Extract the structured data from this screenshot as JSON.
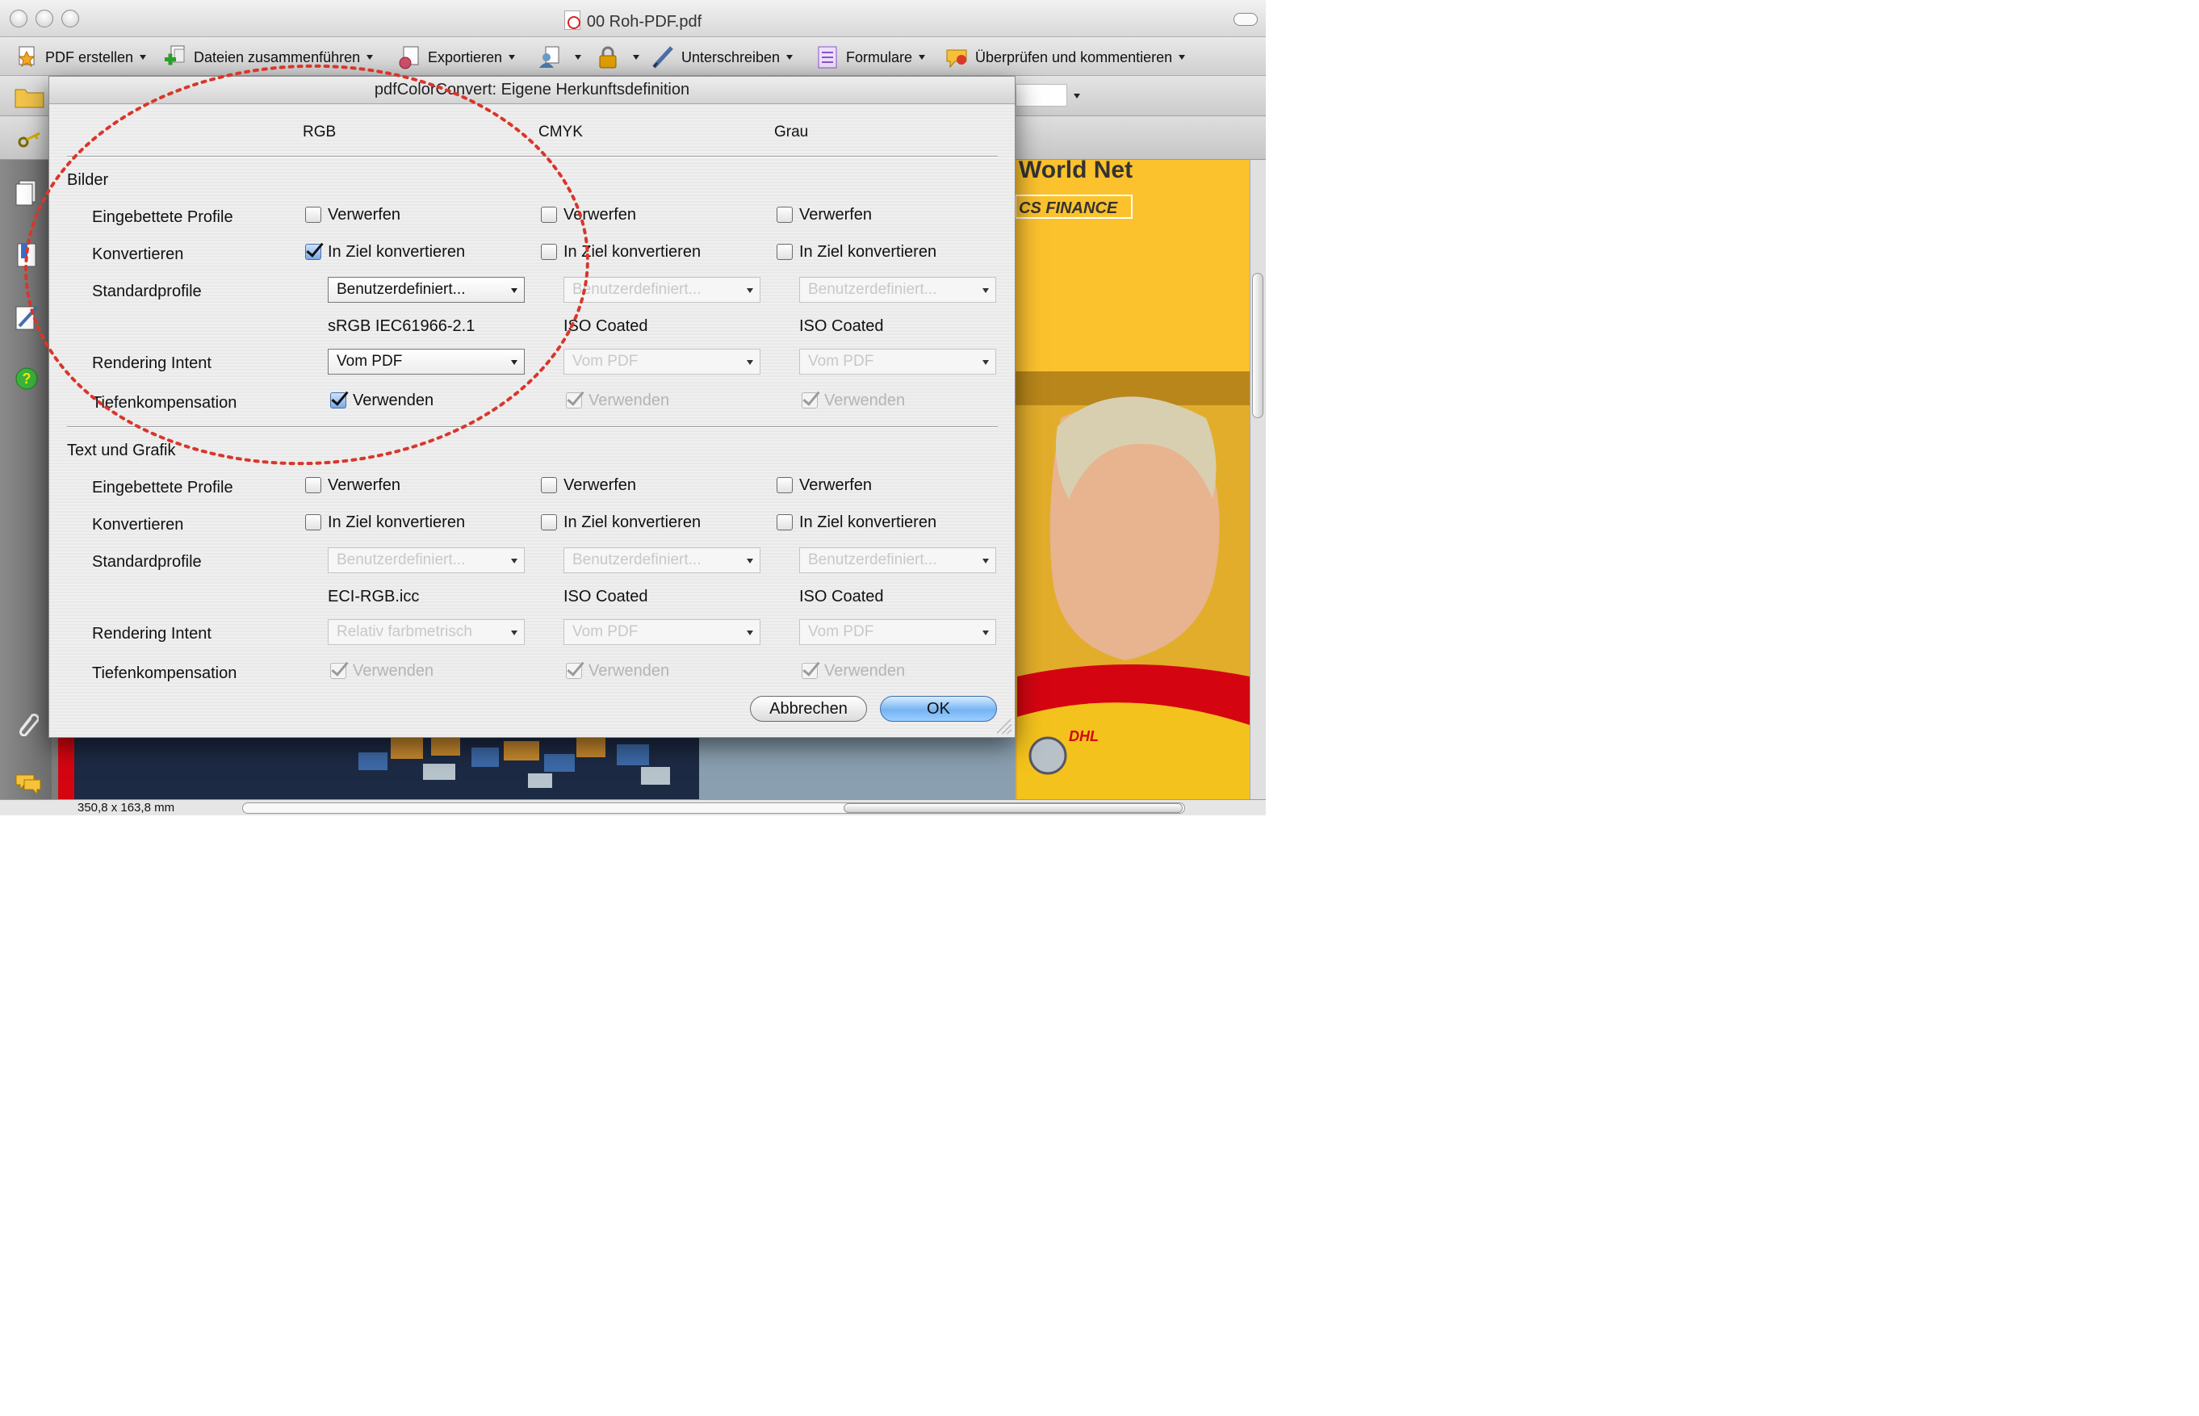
{
  "window": {
    "title": "00 Roh-PDF.pdf"
  },
  "toolbar": {
    "items": [
      {
        "label": "PDF erstellen",
        "icon": "create-pdf-icon"
      },
      {
        "label": "Dateien zusammenführen",
        "icon": "merge-files-icon"
      },
      {
        "label": "Exportieren",
        "icon": "export-icon"
      },
      {
        "label": "",
        "icon": "user-icon"
      },
      {
        "label": "",
        "icon": "lock-icon"
      },
      {
        "label": "Unterschreiben",
        "icon": "sign-pen-icon"
      },
      {
        "label": "Formulare",
        "icon": "forms-icon"
      },
      {
        "label": "Überprüfen und kommentieren",
        "icon": "review-comment-icon"
      }
    ]
  },
  "dialog": {
    "title": "pdfColorConvert: Eigene Herkunftsdefinition",
    "columns": [
      "RGB",
      "CMYK",
      "Grau"
    ],
    "sections": [
      {
        "title": "Bilder",
        "rows": {
          "embedded_label": "Eingebettete Profile",
          "embedded": [
            {
              "label": "Verwerfen",
              "checked": false,
              "enabled": true
            },
            {
              "label": "Verwerfen",
              "checked": false,
              "enabled": true
            },
            {
              "label": "Verwerfen",
              "checked": false,
              "enabled": true
            }
          ],
          "convert_label": "Konvertieren",
          "convert": [
            {
              "label": "In Ziel konvertieren",
              "checked": true,
              "enabled": true
            },
            {
              "label": "In Ziel konvertieren",
              "checked": false,
              "enabled": true
            },
            {
              "label": "In Ziel konvertieren",
              "checked": false,
              "enabled": true
            }
          ],
          "standard_label": "Standardprofile",
          "standard": [
            {
              "value": "Benutzerdefiniert...",
              "enabled": true
            },
            {
              "value": "Benutzerdefiniert...",
              "enabled": false
            },
            {
              "value": "Benutzerdefiniert...",
              "enabled": false
            }
          ],
          "profiles": [
            "sRGB IEC61966-2.1",
            "ISO Coated",
            "ISO Coated"
          ],
          "intent_label": "Rendering Intent",
          "intent": [
            {
              "value": "Vom PDF",
              "enabled": true
            },
            {
              "value": "Vom PDF",
              "enabled": false
            },
            {
              "value": "Vom PDF",
              "enabled": false
            }
          ],
          "depth_label": "Tiefenkompensation",
          "depth": [
            {
              "label": "Verwenden",
              "checked": true,
              "enabled": true
            },
            {
              "label": "Verwenden",
              "checked": true,
              "enabled": false
            },
            {
              "label": "Verwenden",
              "checked": true,
              "enabled": false
            }
          ]
        }
      },
      {
        "title": "Text und Grafik",
        "rows": {
          "embedded_label": "Eingebettete Profile",
          "embedded": [
            {
              "label": "Verwerfen",
              "checked": false,
              "enabled": true
            },
            {
              "label": "Verwerfen",
              "checked": false,
              "enabled": true
            },
            {
              "label": "Verwerfen",
              "checked": false,
              "enabled": true
            }
          ],
          "convert_label": "Konvertieren",
          "convert": [
            {
              "label": "In Ziel konvertieren",
              "checked": false,
              "enabled": true
            },
            {
              "label": "In Ziel konvertieren",
              "checked": false,
              "enabled": true
            },
            {
              "label": "In Ziel konvertieren",
              "checked": false,
              "enabled": true
            }
          ],
          "standard_label": "Standardprofile",
          "standard": [
            {
              "value": "Benutzerdefiniert...",
              "enabled": false
            },
            {
              "value": "Benutzerdefiniert...",
              "enabled": false
            },
            {
              "value": "Benutzerdefiniert...",
              "enabled": false
            }
          ],
          "profiles": [
            "ECI-RGB.icc",
            "ISO Coated",
            "ISO Coated"
          ],
          "intent_label": "Rendering Intent",
          "intent": [
            {
              "value": "Relativ farbmetrisch",
              "enabled": false
            },
            {
              "value": "Vom PDF",
              "enabled": false
            },
            {
              "value": "Vom PDF",
              "enabled": false
            }
          ],
          "depth_label": "Tiefenkompensation",
          "depth": [
            {
              "label": "Verwenden",
              "checked": true,
              "enabled": false
            },
            {
              "label": "Verwenden",
              "checked": true,
              "enabled": false
            },
            {
              "label": "Verwenden",
              "checked": true,
              "enabled": false
            }
          ]
        }
      }
    ],
    "cancel_label": "Abbrechen",
    "ok_label": "OK"
  },
  "document": {
    "headline": "World Net",
    "banner": "CS FINANCE",
    "logo": "DHL"
  },
  "statusbar": {
    "page_size": "350,8 x 163,8 mm"
  },
  "colors": {
    "dhl_yellow": "#fcc22e",
    "dhl_red": "#d40511",
    "annotation_red": "#d9362b",
    "default_button_blue": "#76b3f2"
  }
}
